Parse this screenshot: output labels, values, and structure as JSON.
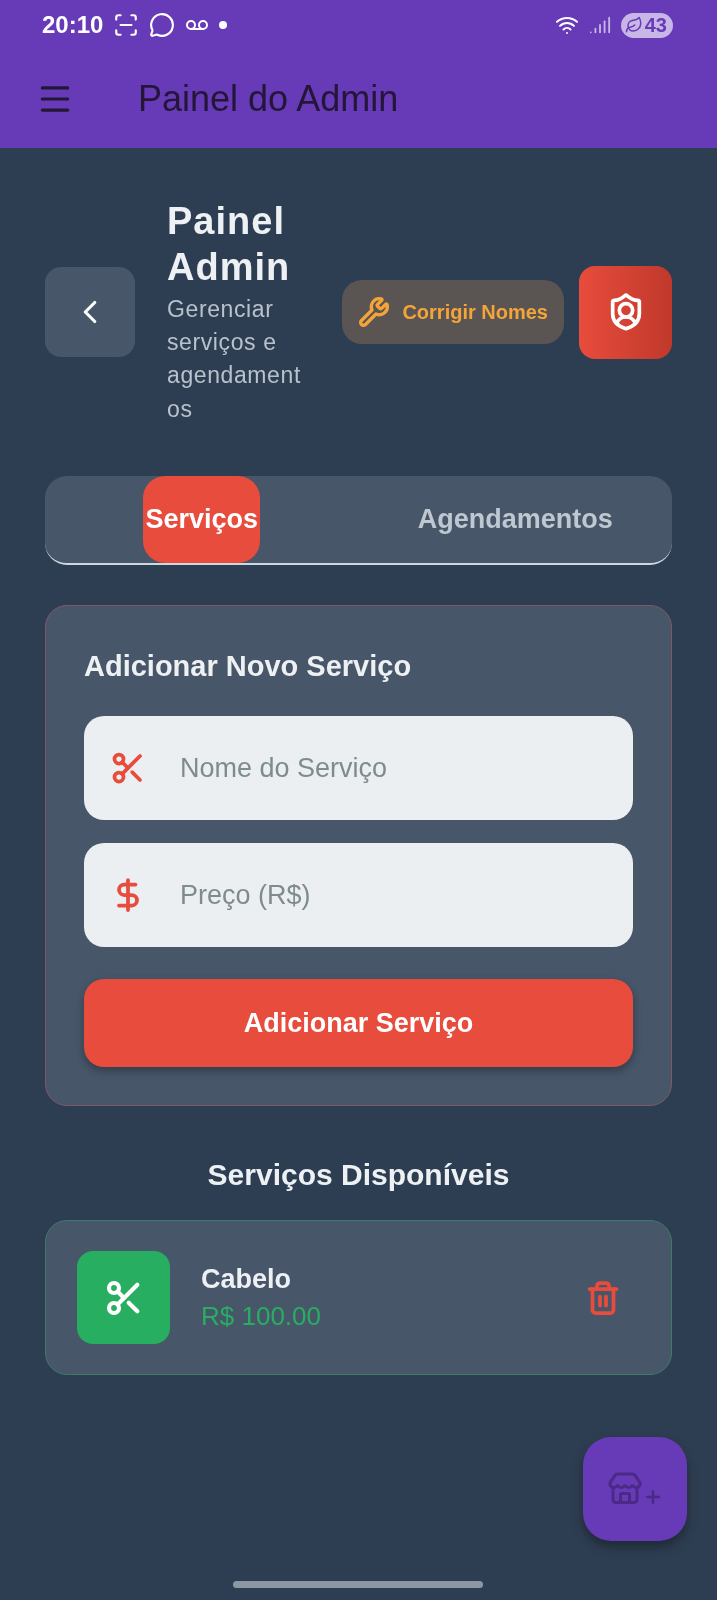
{
  "status_bar": {
    "time": "20:10",
    "battery": "43"
  },
  "app_bar": {
    "title": "Painel do Admin"
  },
  "header": {
    "title": "Painel Admin",
    "subtitle": "Gerenciar serviços e agendamentos",
    "fix_button": "Corrigir Nomes"
  },
  "tabs": [
    {
      "label": "Serviços",
      "selected": true
    },
    {
      "label": "Agendamentos",
      "selected": false
    }
  ],
  "form": {
    "title": "Adicionar Novo Serviço",
    "fields": [
      {
        "kind": "name",
        "placeholder": "Nome do Serviço"
      },
      {
        "kind": "price",
        "placeholder": "Preço (R$)"
      }
    ],
    "submit": "Adicionar Serviço"
  },
  "services": {
    "title": "Serviços Disponíveis",
    "items": [
      {
        "name": "Cabelo",
        "price": "R$ 100.00"
      }
    ]
  }
}
